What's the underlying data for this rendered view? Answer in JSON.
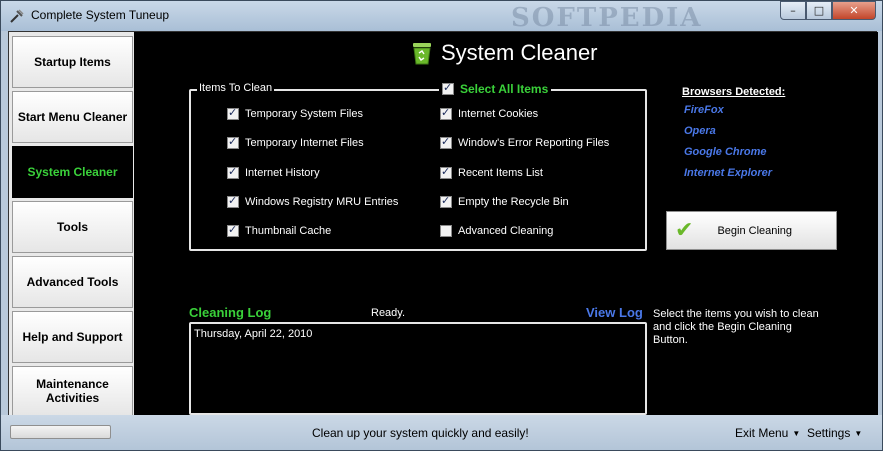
{
  "window": {
    "title": "Complete System Tuneup",
    "min_glyph": "–",
    "max_glyph": "□",
    "close_glyph": "✕"
  },
  "sidebar": {
    "items": [
      {
        "label": "Startup Items",
        "active": false
      },
      {
        "label": "Start Menu Cleaner",
        "active": false
      },
      {
        "label": "System Cleaner",
        "active": true
      },
      {
        "label": "Tools",
        "active": false
      },
      {
        "label": "Advanced Tools",
        "active": false
      },
      {
        "label": "Help and Support",
        "active": false
      },
      {
        "label": "Maintenance Activities",
        "active": false
      }
    ]
  },
  "main": {
    "title": "System Cleaner",
    "title_icon": "recycle-bin-icon",
    "items_to_clean_label": "Items To Clean",
    "select_all": {
      "label": "Select All Items",
      "checked": true
    },
    "left_options": [
      {
        "label": "Temporary System Files",
        "checked": true
      },
      {
        "label": "Temporary Internet Files",
        "checked": true
      },
      {
        "label": "Internet History",
        "checked": true
      },
      {
        "label": "Windows Registry MRU Entries",
        "checked": true
      },
      {
        "label": "Thumbnail Cache",
        "checked": true
      }
    ],
    "right_options": [
      {
        "label": "Internet Cookies",
        "checked": true
      },
      {
        "label": "Window's Error Reporting Files",
        "checked": true
      },
      {
        "label": "Recent Items List",
        "checked": true
      },
      {
        "label": "Empty the Recycle Bin",
        "checked": true
      },
      {
        "label": "Advanced Cleaning",
        "checked": false
      }
    ],
    "browsers_title": "Browsers Detected:",
    "browsers": [
      "FireFox",
      "Opera",
      "Google Chrome",
      "Internet Explorer"
    ],
    "begin_button": "Begin Cleaning",
    "begin_icon": "checkmark-icon",
    "log_title": "Cleaning Log",
    "status": "Ready.",
    "view_log": "View Log",
    "log_lines": [
      "Thursday, April 22, 2010"
    ],
    "hint": "Select the items you wish to clean and click the Begin Cleaning Button.",
    "watermark": "SOFTPEDIA"
  },
  "statusbar": {
    "tagline": "Clean up your system quickly and easily!",
    "exit_menu": "Exit Menu",
    "settings": "Settings"
  },
  "colors": {
    "accent_green": "#3ad13a",
    "link_blue": "#4a78e8",
    "background": "#000000"
  }
}
